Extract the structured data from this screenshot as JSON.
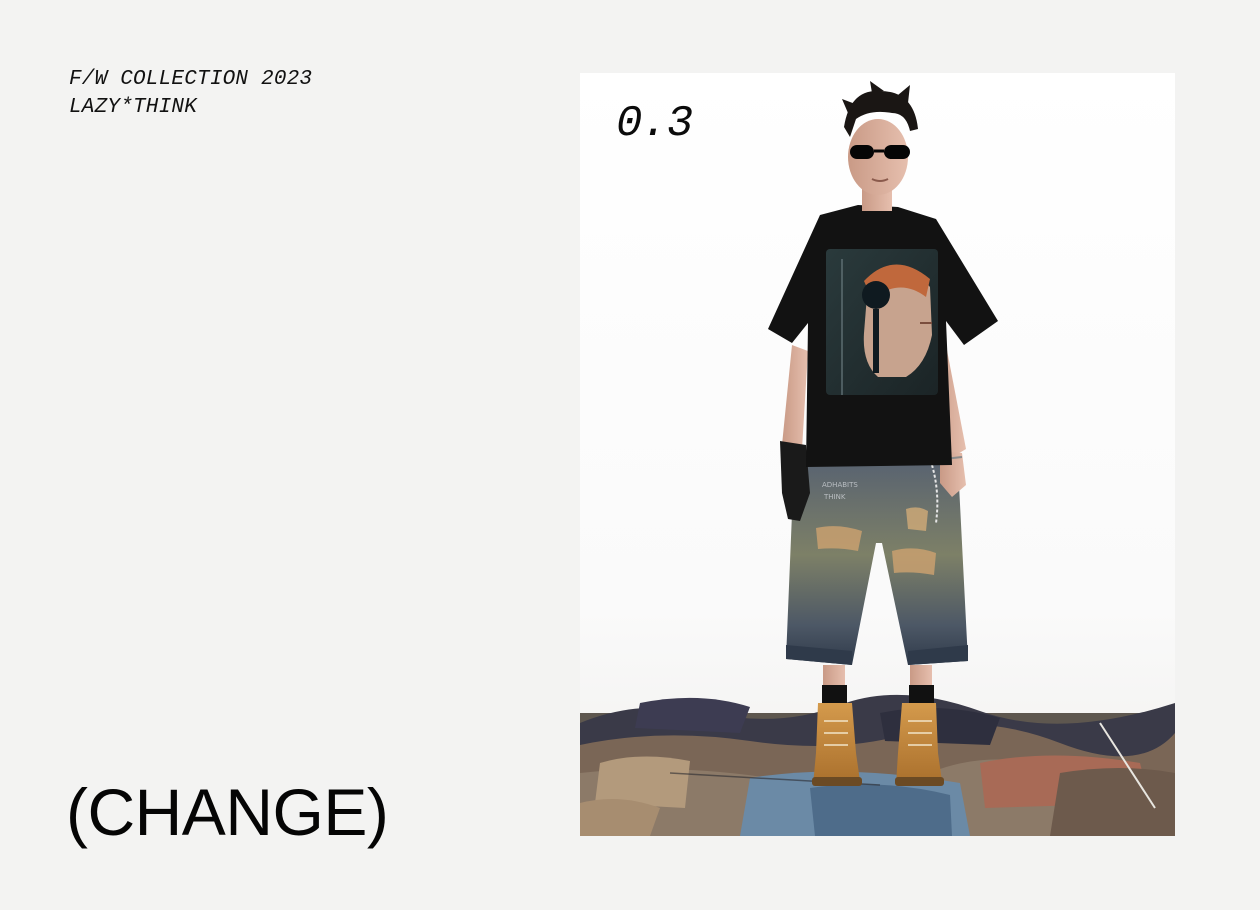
{
  "collection": {
    "line1": "F/W COLLECTION 2023",
    "line2": "LAZY*THINK"
  },
  "headline": "(CHANGE)",
  "photo": {
    "number": "0.3",
    "subject": "model-photo"
  },
  "colors": {
    "background": "#f3f3f2",
    "panel": "#ffffff",
    "text": "#0a0a0a"
  }
}
